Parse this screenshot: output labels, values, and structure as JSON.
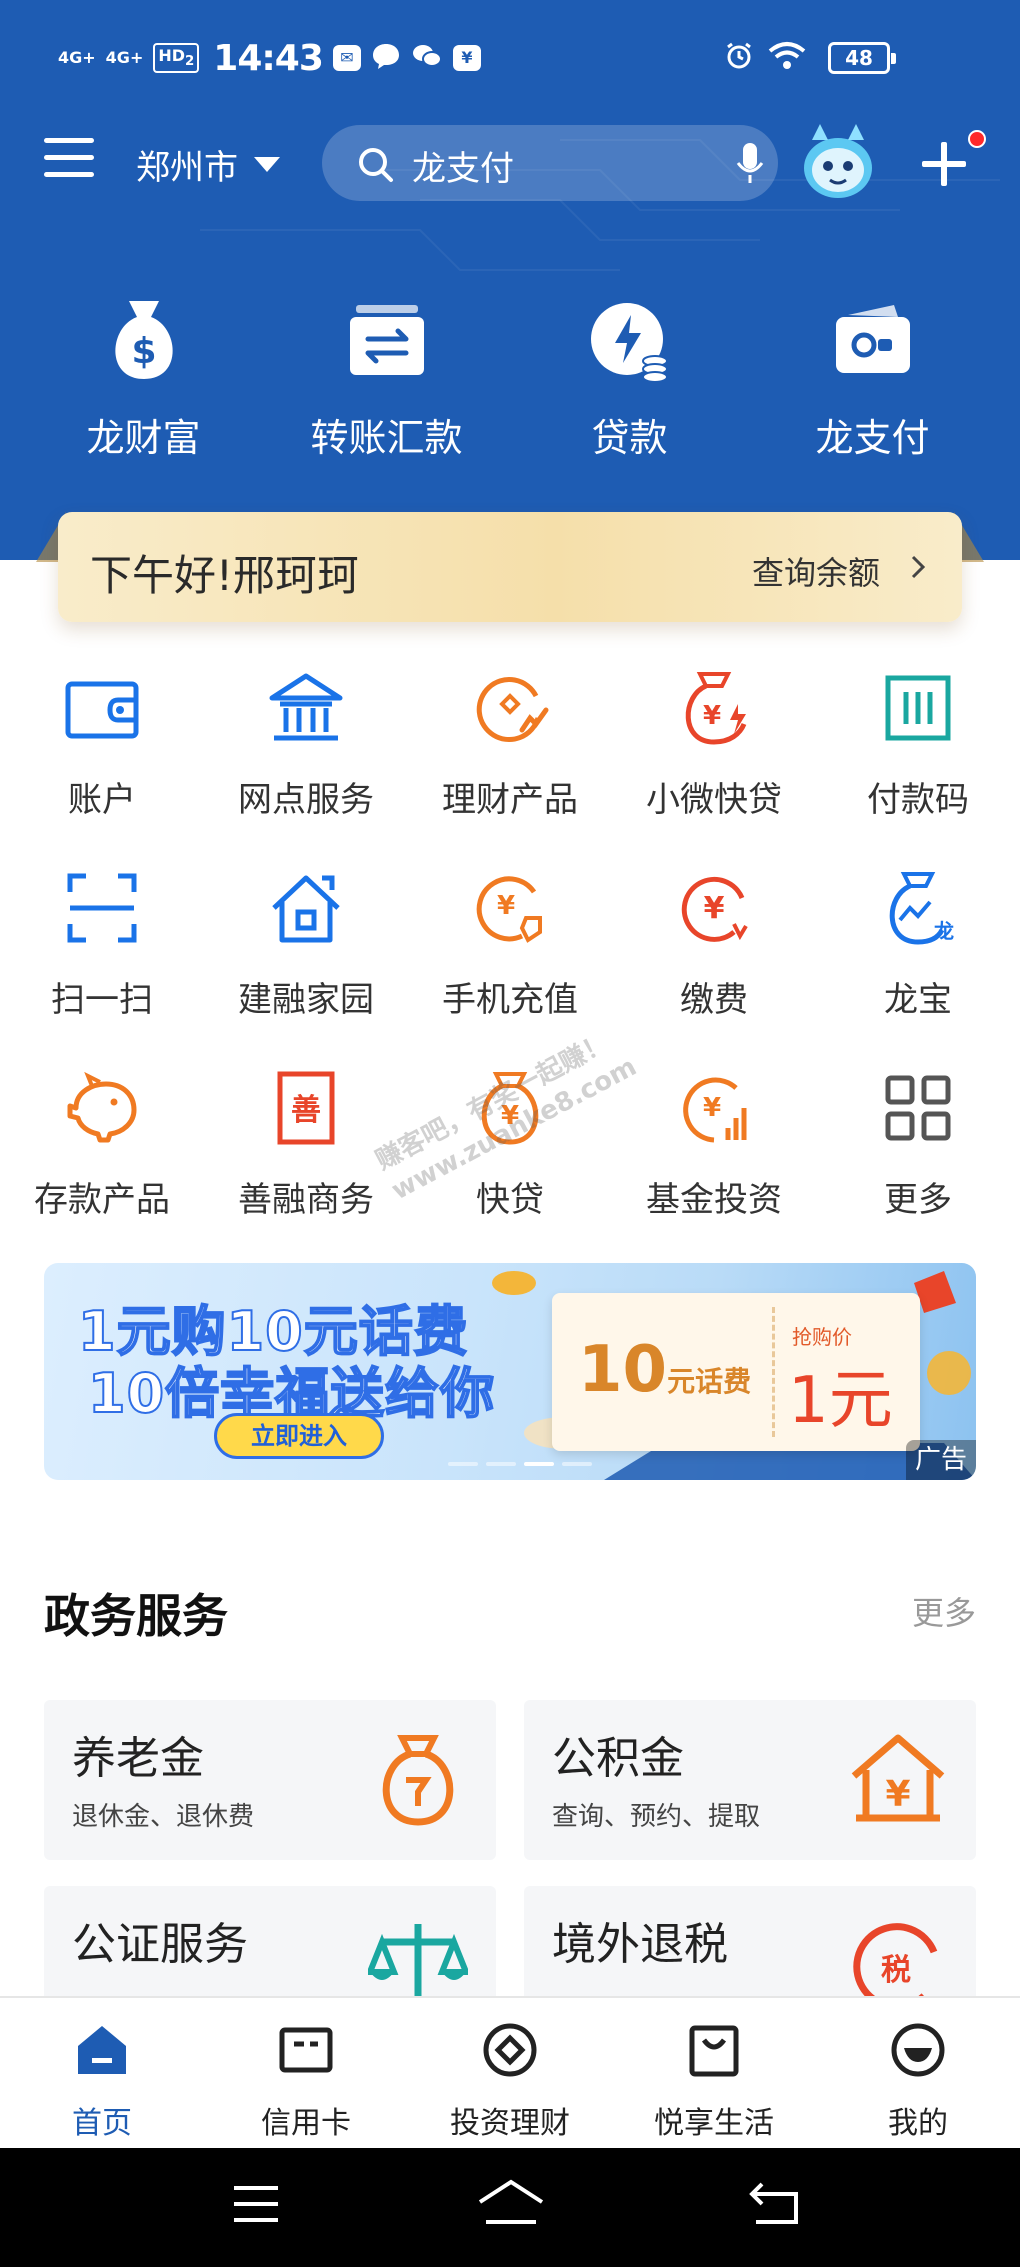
{
  "status_bar": {
    "network_1": "4G+",
    "network_2": "4G+",
    "hd_badge": "HD",
    "hd_sub": "2",
    "time": "14:43",
    "battery": "48",
    "app_badge": "¥"
  },
  "top_bar": {
    "city": "郑州市",
    "search_placeholder": "龙支付"
  },
  "hero_menu": [
    {
      "label": "龙财富",
      "icon": "money-bag-icon"
    },
    {
      "label": "转账汇款",
      "icon": "transfer-icon"
    },
    {
      "label": "贷款",
      "icon": "loan-icon"
    },
    {
      "label": "龙支付",
      "icon": "wallet-icon"
    }
  ],
  "greeting": {
    "text": "下午好!邢珂珂",
    "action": "查询余额"
  },
  "grid": [
    {
      "label": "账户",
      "icon": "account-wallet-icon"
    },
    {
      "label": "网点服务",
      "icon": "bank-branch-icon"
    },
    {
      "label": "理财产品",
      "icon": "wealth-product-icon"
    },
    {
      "label": "小微快贷",
      "icon": "quick-loan-icon"
    },
    {
      "label": "付款码",
      "icon": "pay-code-icon"
    },
    {
      "label": "扫一扫",
      "icon": "scan-icon"
    },
    {
      "label": "建融家园",
      "icon": "home-icon"
    },
    {
      "label": "手机充值",
      "icon": "phone-recharge-icon"
    },
    {
      "label": "缴费",
      "icon": "bill-payment-icon"
    },
    {
      "label": "龙宝",
      "icon": "longbao-icon"
    },
    {
      "label": "存款产品",
      "icon": "piggy-bank-icon"
    },
    {
      "label": "善融商务",
      "icon": "shanrong-icon"
    },
    {
      "label": "快贷",
      "icon": "kuaidai-icon"
    },
    {
      "label": "基金投资",
      "icon": "fund-icon"
    },
    {
      "label": "更多",
      "icon": "more-grid-icon"
    }
  ],
  "banner": {
    "line1": "1元购10元话费",
    "line2": "10倍幸福送给你",
    "button": "立即进入",
    "coupon_value": "10",
    "coupon_unit": "元话费",
    "price_label": "抢购价",
    "price": "1元",
    "ad_tag": "广告"
  },
  "watermark": {
    "line1": "赚客吧，有奖一起赚！",
    "line2": "www.zuanke8.com"
  },
  "gov_services": {
    "title": "政务服务",
    "more": "更多",
    "items": [
      {
        "title": "养老金",
        "subtitle": "退休金、退休费",
        "icon": "pension-bag-icon"
      },
      {
        "title": "公积金",
        "subtitle": "查询、预约、提取",
        "icon": "housing-fund-icon"
      },
      {
        "title": "公证服务",
        "subtitle": "",
        "icon": "scales-icon"
      },
      {
        "title": "境外退税",
        "subtitle": "",
        "icon": "tax-refund-icon"
      }
    ]
  },
  "tab_bar": [
    {
      "label": "首页",
      "active": true
    },
    {
      "label": "信用卡",
      "active": false
    },
    {
      "label": "投资理财",
      "active": false
    },
    {
      "label": "悦享生活",
      "active": false
    },
    {
      "label": "我的",
      "active": false
    }
  ],
  "colors": {
    "brand_blue": "#1e5cb3",
    "accent_orange": "#f07a22",
    "accent_red": "#e8452a",
    "accent_teal": "#1aa7a0"
  }
}
